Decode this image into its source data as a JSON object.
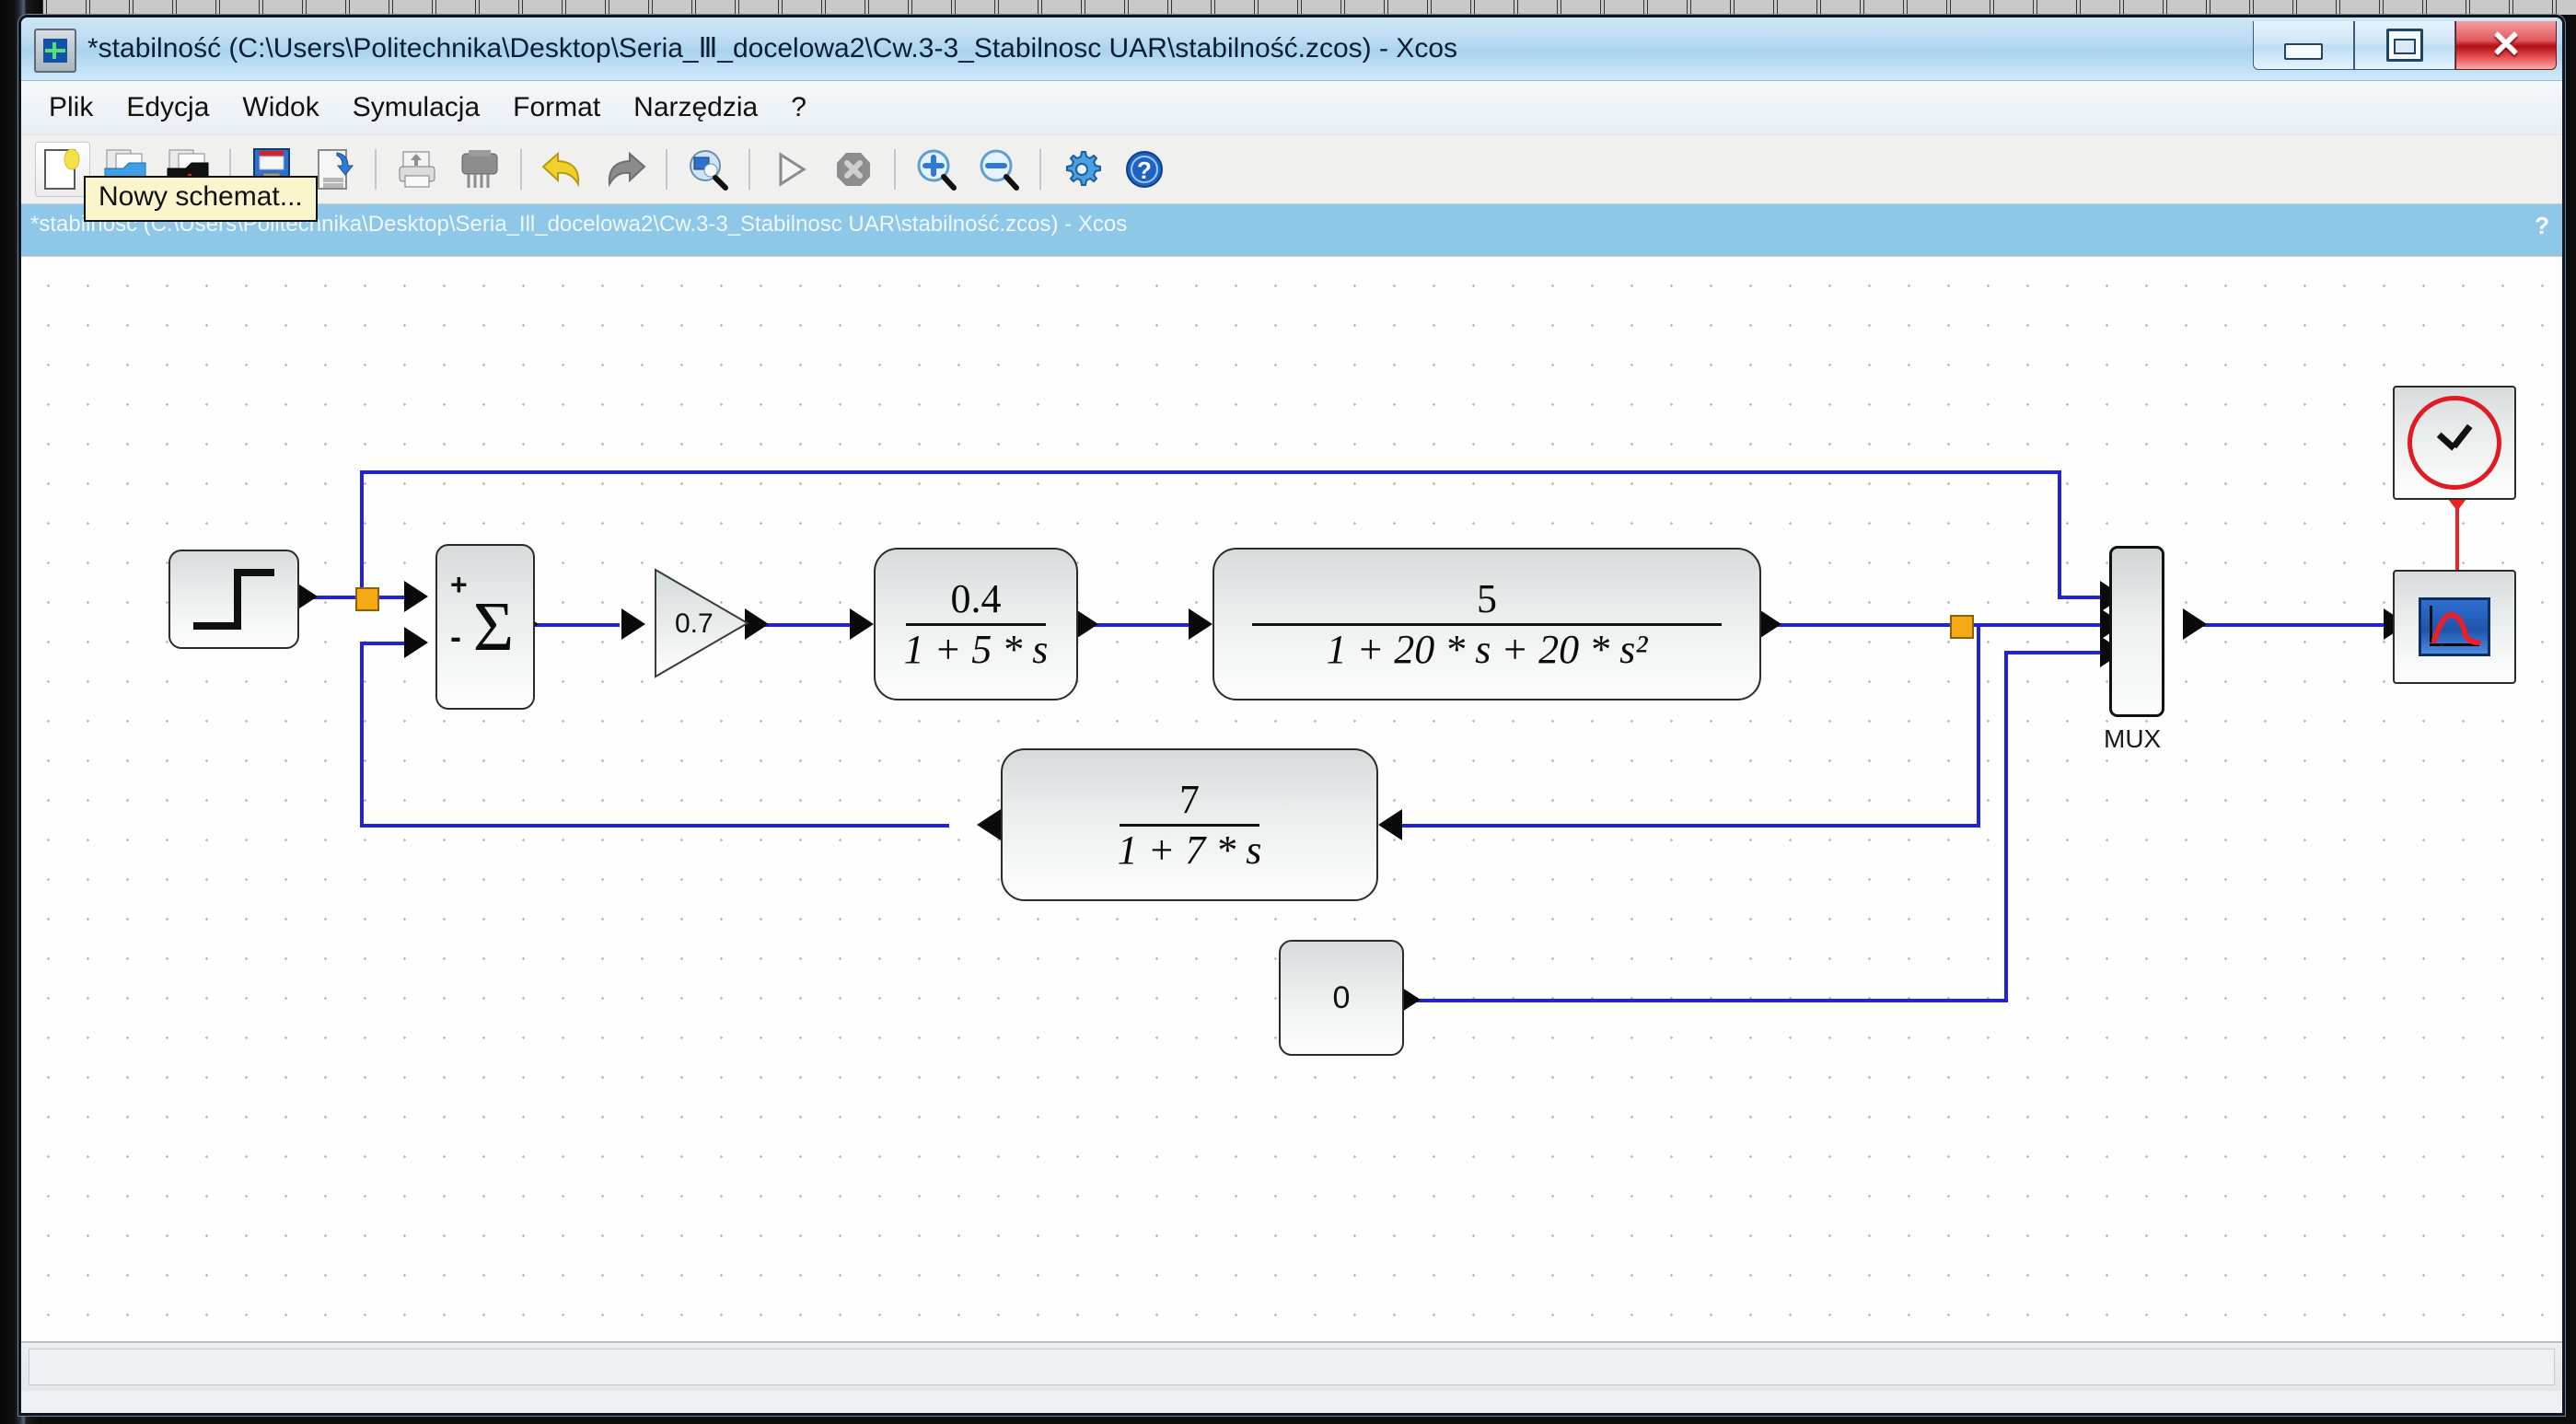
{
  "window": {
    "title": "*stabilność (C:\\Users\\Politechnika\\Desktop\\Seria_Ⅲ_docelowa2\\Cw.3-3_Stabilnosc UAR\\stabilność.zcos) - Xcos",
    "app_icon": "xcos-icon",
    "minimize_label": "",
    "maximize_label": "",
    "close_label": "✕"
  },
  "menubar": {
    "items": [
      {
        "label": "Plik"
      },
      {
        "label": "Edycja"
      },
      {
        "label": "Widok"
      },
      {
        "label": "Symulacja"
      },
      {
        "label": "Format"
      },
      {
        "label": "Narzędzia"
      },
      {
        "label": "?"
      }
    ]
  },
  "toolbar": {
    "items": [
      {
        "name": "new-diagram-button",
        "icon": "new-document-icon"
      },
      {
        "name": "open-file-button",
        "icon": "open-folder-icon"
      },
      {
        "name": "open-recent-button",
        "icon": "open-folder-demo-icon"
      },
      {
        "name": "save-button",
        "icon": "floppy-disk-icon"
      },
      {
        "name": "save-as-button",
        "icon": "save-as-icon"
      },
      {
        "name": "export-button",
        "icon": "printer-export-icon"
      },
      {
        "name": "print-button",
        "icon": "printer-icon"
      },
      {
        "name": "undo-button",
        "icon": "undo-arrow-icon"
      },
      {
        "name": "redo-button",
        "icon": "redo-arrow-icon"
      },
      {
        "name": "fit-to-view-button",
        "icon": "zoom-region-icon"
      },
      {
        "name": "start-simulation-button",
        "icon": "play-triangle-icon"
      },
      {
        "name": "stop-simulation-button",
        "icon": "stop-octagon-icon"
      },
      {
        "name": "zoom-in-button",
        "icon": "zoom-in-icon"
      },
      {
        "name": "zoom-out-button",
        "icon": "zoom-out-icon"
      },
      {
        "name": "set-parameters-button",
        "icon": "gear-icon"
      },
      {
        "name": "help-button",
        "icon": "question-mark-icon"
      }
    ]
  },
  "subbar": {
    "title": "*stabilność (C:\\Users\\Politechnika\\Desktop\\Seria_Ill_docelowa2\\Cw.3-3_Stabilnosc UAR\\stabilność.zcos) - Xcos",
    "help": "?"
  },
  "tooltip": {
    "text": "Nowy schemat..."
  },
  "statusbar": {
    "text": ""
  },
  "diagram": {
    "blocks": [
      {
        "name": "step-function-block",
        "type": "STEP_FUNCTION",
        "label": ""
      },
      {
        "name": "summation-block",
        "type": "SUMMATION",
        "label": "Σ",
        "plus": "+",
        "minus": "-"
      },
      {
        "name": "gain-block",
        "type": "GAINBLK",
        "label": "0.7"
      },
      {
        "name": "transfer-function-1",
        "type": "CLR",
        "numerator": "0.4",
        "denominator": "1 + 5 * s"
      },
      {
        "name": "transfer-function-2",
        "type": "CLR",
        "numerator": "5",
        "denominator": "1 + 20 * s + 20 * s²"
      },
      {
        "name": "feedback-transfer-function",
        "type": "CLR",
        "numerator": "7",
        "denominator": "1 + 7 * s"
      },
      {
        "name": "constant-block",
        "type": "CONST_m",
        "label": "0"
      },
      {
        "name": "mux-block",
        "type": "MUX",
        "label": "MUX"
      },
      {
        "name": "clock-block",
        "type": "CLOCK_c",
        "label": ""
      },
      {
        "name": "scope-block",
        "type": "CSCOPE",
        "label": ""
      }
    ],
    "colors": {
      "link": "#2222dd",
      "event_link": "#ee2222",
      "split_point": "#f5a916",
      "block_border": "#2b2b2b"
    }
  }
}
